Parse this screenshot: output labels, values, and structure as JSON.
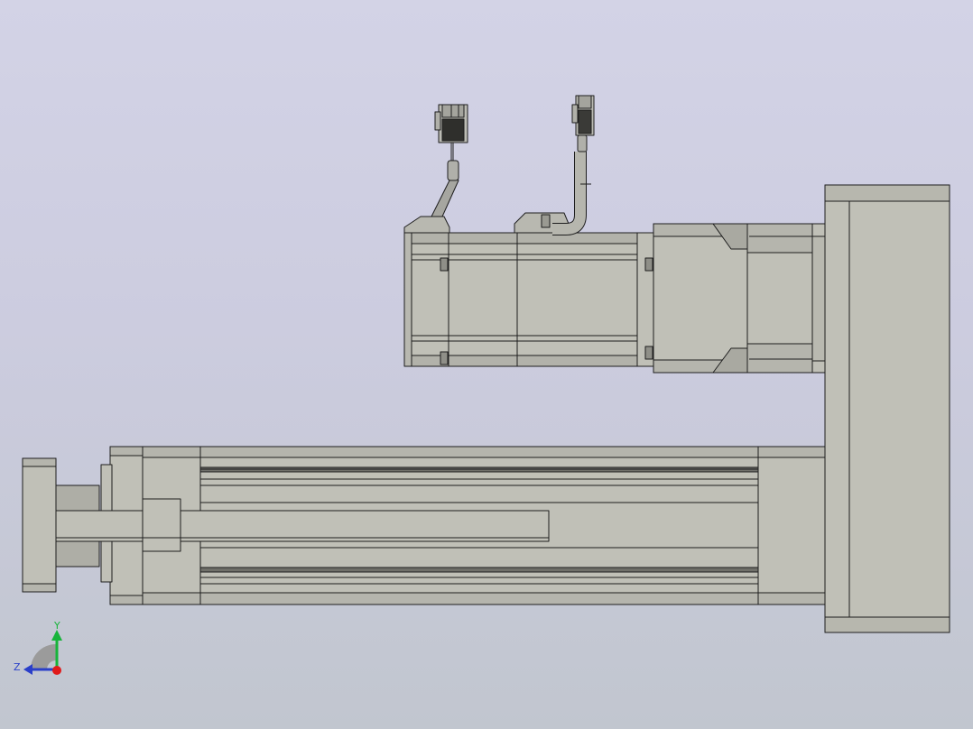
{
  "window": {
    "title": ""
  },
  "model": {
    "name": "",
    "components": [
      "actuator-body",
      "piston-rod",
      "front-flange",
      "motor",
      "encoder-cable",
      "power-cable",
      "connector",
      "reducer",
      "side-plate"
    ]
  },
  "triad": {
    "y_label": "Y",
    "z_label": "Z",
    "x_icon": "x-axis-dot"
  },
  "colors": {
    "background_top": "#d3d3e6",
    "background_bottom": "#c1c6cf",
    "body": "#c0c0b7",
    "edge": "#1e1e1e",
    "y_axis": "#17b43a",
    "z_axis": "#2a3fc9",
    "x_axis": "#e01a1a"
  }
}
